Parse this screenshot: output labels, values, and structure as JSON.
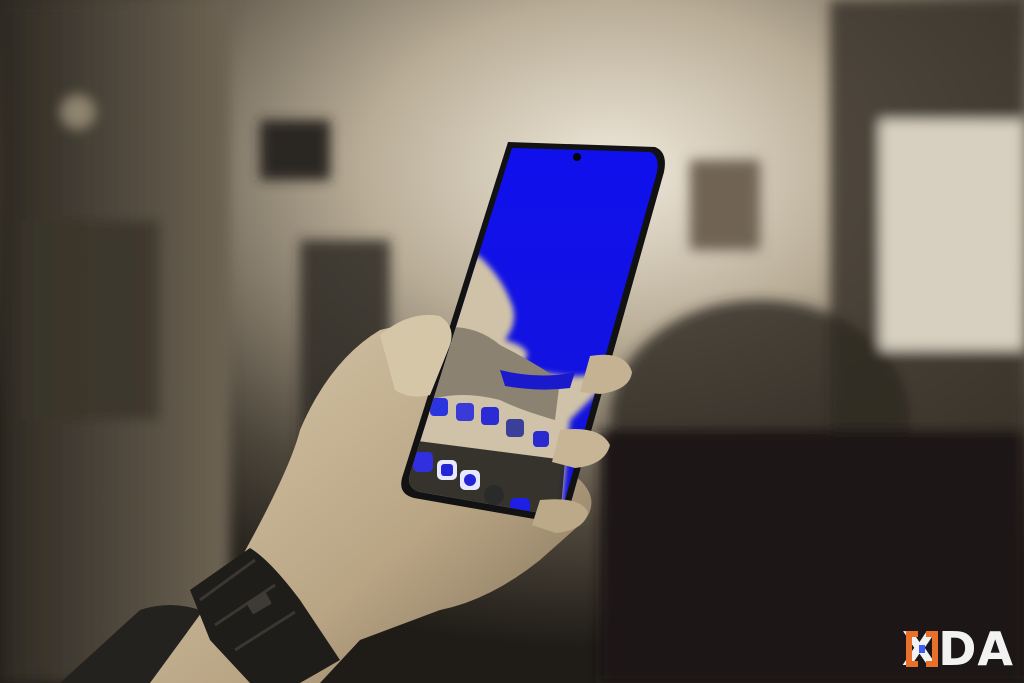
{
  "photo": {
    "description_icon": "hand-holding-phone-photo",
    "colors": {
      "background_light": "#cfc5b3",
      "background_dark": "#2a2620",
      "screen_sky": "#1212e8",
      "phone_frame": "#121212",
      "skin": "#c9b89c",
      "watch_strap": "#1f1d1a"
    }
  },
  "watermark": {
    "brand_text": "XDA",
    "bracket_color": "#e8702a",
    "bracket_accent": "#3c5cff"
  }
}
